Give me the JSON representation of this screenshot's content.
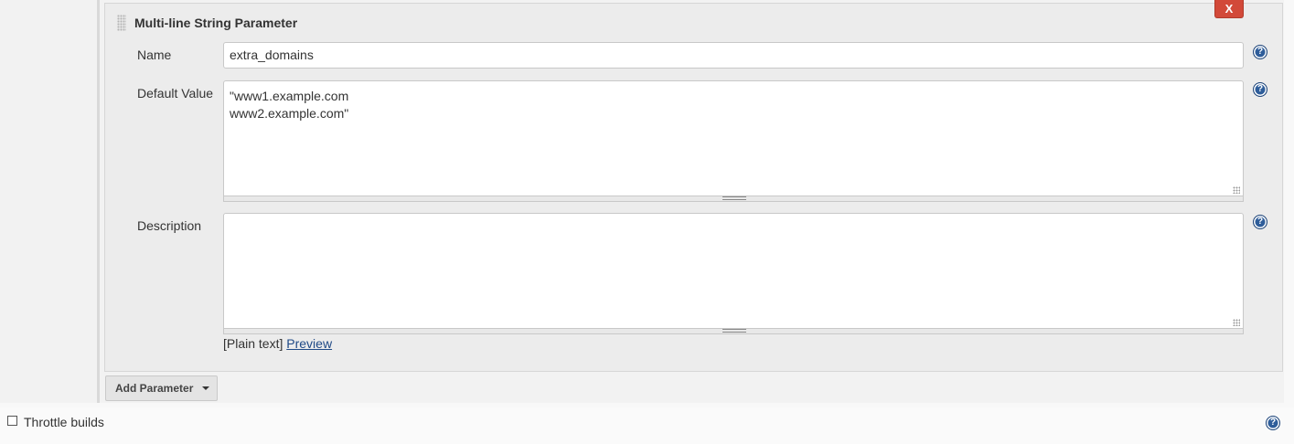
{
  "parameter": {
    "title": "Multi-line String Parameter",
    "delete_label": "X",
    "name_label": "Name",
    "name_value": "extra_domains",
    "default_label": "Default Value",
    "default_value": "\"www1.example.com\nwww2.example.com\"",
    "description_label": "Description",
    "description_value": "",
    "markup_prefix": "[Plain text]",
    "preview_label": "Preview"
  },
  "add_parameter_label": "Add Parameter",
  "throttle": {
    "label": "Throttle builds",
    "checked": false
  },
  "icons": {
    "help": "question-circle-icon",
    "drag": "drag-handle-icon",
    "dropdown": "caret-down-icon"
  },
  "colors": {
    "delete_button": "#d24939",
    "help_icon": "#2e5d9a",
    "link": "#204a87"
  }
}
